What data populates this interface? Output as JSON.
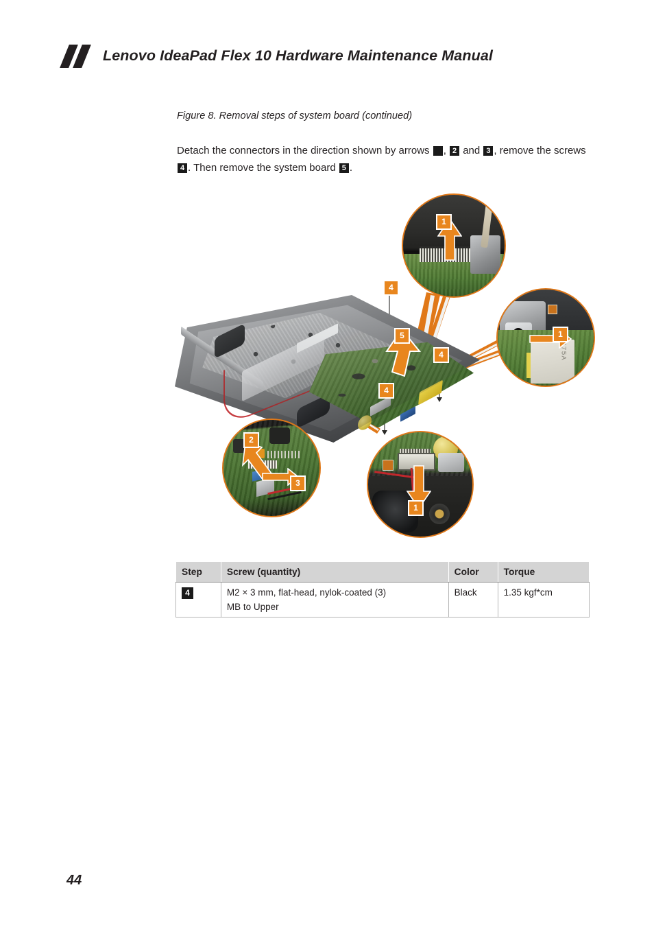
{
  "document": {
    "header_title": "Lenovo IdeaPad Flex 10 Hardware Maintenance Manual",
    "logo_name": "lenovo-slash-mark",
    "page_number": "44"
  },
  "figure": {
    "caption": "Figure 8. Removal steps of system board (continued)",
    "instruction": {
      "part1": "Detach the connectors in the direction shown by arrows ",
      "badge1": "1",
      "sep1": ", ",
      "badge2": "2",
      "sep2": " and ",
      "badge3": "3",
      "part2": ", remove the screws ",
      "badge4": "4",
      "part3": ". Then remove the system board ",
      "badge5": "5",
      "part4": "."
    },
    "callouts": [
      {
        "id": "top",
        "badge": "1",
        "arrow": "up",
        "detail_text": ""
      },
      {
        "id": "right",
        "badge": "1",
        "arrow": "right",
        "detail_text": "375A"
      },
      {
        "id": "bottom-left-2",
        "badge": "2",
        "arrow": "up-left",
        "detail_text": ""
      },
      {
        "id": "bottom-left-3",
        "badge": "3",
        "arrow": "right",
        "detail_text": ""
      },
      {
        "id": "bottom-center",
        "badge": "1",
        "arrow": "down",
        "detail_text": ""
      }
    ],
    "board_badges": [
      {
        "id": "screw-top",
        "label": "4"
      },
      {
        "id": "screw-right",
        "label": "4"
      },
      {
        "id": "screw-bottom",
        "label": "4"
      },
      {
        "id": "board-lift",
        "label": "5"
      }
    ],
    "colors": {
      "badge_orange": "#e8861e",
      "callout_ring": "#e07818",
      "arrow_orange": "#e8861e",
      "badge_black": "#1a1a1a"
    }
  },
  "table": {
    "headers": {
      "step": "Step",
      "screw": "Screw (quantity)",
      "color": "Color",
      "torque": "Torque"
    },
    "rows": [
      {
        "step": "4",
        "screw_line1": "M2 × 3 mm, flat-head, nylok-coated (3)",
        "screw_line2": "MB to Upper",
        "color": "Black",
        "torque": "1.35 kgf*cm"
      }
    ]
  }
}
